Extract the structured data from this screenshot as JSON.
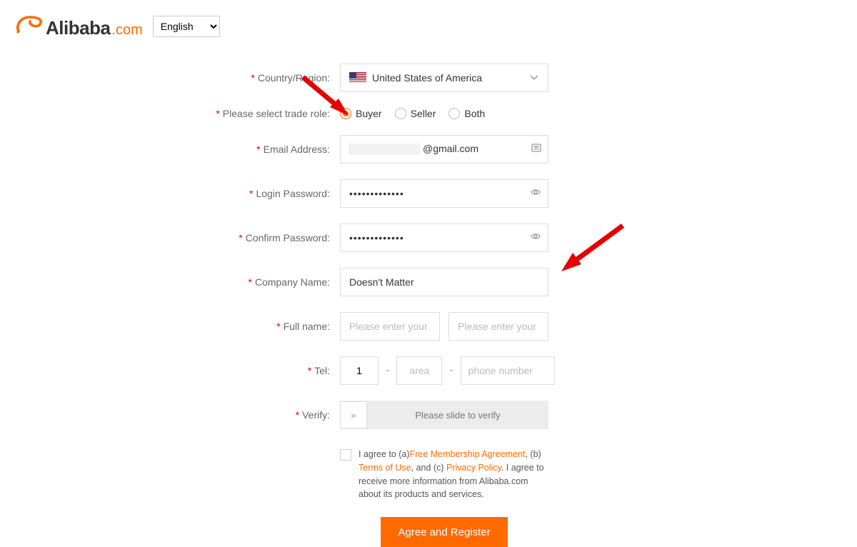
{
  "header": {
    "brand_main": "Alibaba",
    "brand_suffix": ".com",
    "language": "English"
  },
  "form": {
    "country_label": "Country/Region:",
    "country_value": "United States of America",
    "trade_role_label": "Please select trade role:",
    "roles": {
      "buyer": "Buyer",
      "seller": "Seller",
      "both": "Both"
    },
    "email_label": "Email Address:",
    "email_value": "@gmail.com",
    "password_label": "Login Password:",
    "password_value": "•••••••••••••",
    "confirm_label": "Confirm Password:",
    "confirm_value": "•••••••••••••",
    "company_label": "Company Name:",
    "company_value": "Doesn't Matter",
    "fullname_label": "Full name:",
    "firstname_placeholder": "Please enter your firs",
    "lastname_placeholder": "Please enter your las",
    "tel_label": "Tel:",
    "tel_code": "1",
    "tel_area_placeholder": "area",
    "tel_number_placeholder": "phone number",
    "dash": "-",
    "verify_label": "Verify:",
    "verify_handle": "»",
    "verify_text": "Please slide to verify",
    "agree_prefix": "I agree to (a)",
    "agree_link_membership": "Free Membership Agreement",
    "agree_mid1": ", (b) ",
    "agree_link_terms": "Terms of Use",
    "agree_mid2": ", and (c) ",
    "agree_link_privacy": "Privacy Policy",
    "agree_suffix": ". I agree to receive more information from Alibaba.com about its products and services.",
    "submit": "Agree and Register"
  }
}
